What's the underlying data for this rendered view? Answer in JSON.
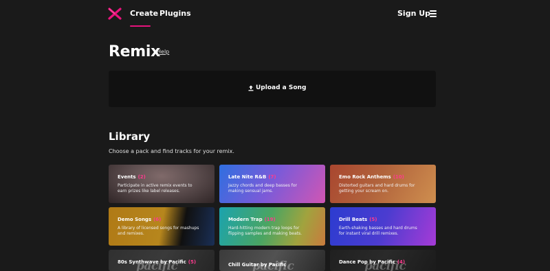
{
  "nav": {
    "create": "Create",
    "plugins": "Plugins",
    "signup": "Sign Up"
  },
  "header": {
    "title": "Remix",
    "help": "Help"
  },
  "upload": {
    "label": "Upload a Song"
  },
  "library": {
    "title": "Library",
    "description": "Choose a pack and find tracks for your remix.",
    "cards": [
      {
        "title": "Events",
        "count": "(2)",
        "desc": "Participate in active remix events to earn prizes like label releases."
      },
      {
        "title": "Late Nite R&B",
        "count": "(7)",
        "desc": "Jazzy chords and deep basses for making sensual jams."
      },
      {
        "title": "Emo Rock Anthems",
        "count": "(10)",
        "desc": "Distorted guitars and hard drums for getting your scream on."
      },
      {
        "title": "Demo Songs",
        "count": "(6)",
        "desc": "A library of licensed songs for mashups and remixes."
      },
      {
        "title": "Modern Trap",
        "count": "(19)",
        "desc": "Hard-hitting modern trap loops for flipping samples and making beats."
      },
      {
        "title": "Drill Beats",
        "count": "(5)",
        "desc": "Earth-shaking basses and hard drums for instant viral drill remixes."
      },
      {
        "title": "80s Synthwave by Pacific",
        "count": "(5)",
        "desc": ""
      },
      {
        "title": "Chill Guitar by Pacific",
        "count": "",
        "desc": ""
      },
      {
        "title": "Dance Pop by Pacific",
        "count": "(4)",
        "desc": ""
      }
    ],
    "watermark": "pacific"
  },
  "colors": {
    "background": "#1a1a1a",
    "accent": "#e8127c",
    "upload_box": "#111111"
  },
  "icons": {
    "logo": "crossed-x-logo",
    "menu": "hamburger-menu-icon",
    "upload": "upload-arrow-icon"
  }
}
